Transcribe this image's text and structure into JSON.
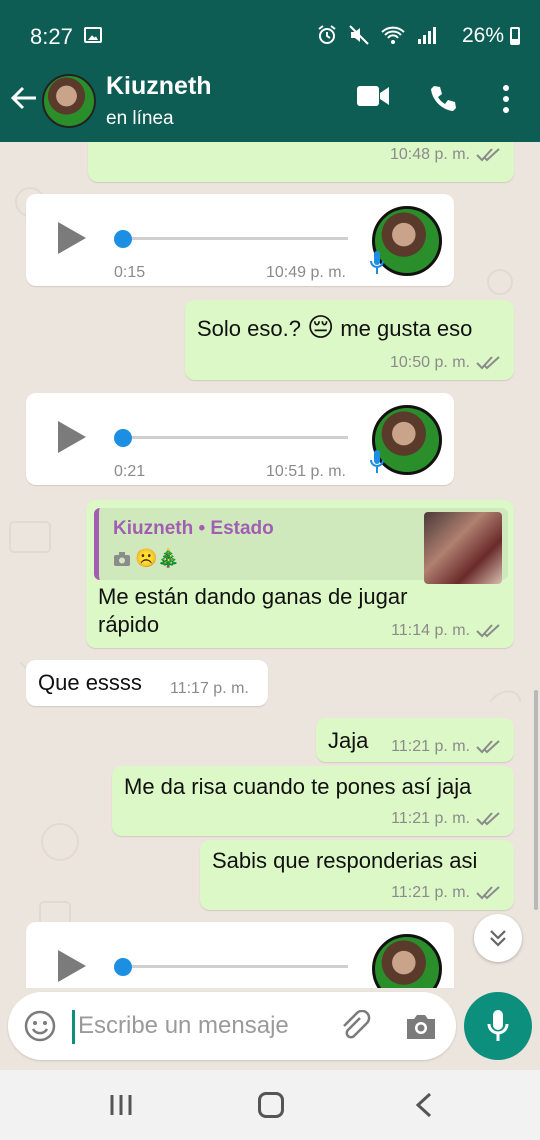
{
  "status_bar": {
    "time": "8:27",
    "battery": "26%",
    "battery_level": 0.26
  },
  "header": {
    "contact_name": "Kiuzneth",
    "contact_status": "en línea"
  },
  "messages": [
    {
      "type": "outgoing-text-partial",
      "time": "10:48 p. m."
    },
    {
      "type": "incoming-voice",
      "duration": "0:15",
      "time": "10:49 p. m."
    },
    {
      "type": "outgoing-text",
      "text_before": "Solo eso.?",
      "emoji": "😔",
      "text_after": "me gusta eso",
      "time": "10:50 p. m."
    },
    {
      "type": "incoming-voice",
      "duration": "0:21",
      "time": "10:51 p. m."
    },
    {
      "type": "outgoing-reply",
      "reply_name": "Kiuzneth • Estado",
      "reply_emojis": "☹️🎄",
      "line1": "Me están dando ganas de jugar",
      "line2": "rápido",
      "time": "11:14 p. m."
    },
    {
      "type": "incoming-text",
      "text": "Que essss",
      "time": "11:17 p. m."
    },
    {
      "type": "outgoing-text",
      "text": "Jaja",
      "time": "11:21 p. m."
    },
    {
      "type": "outgoing-text",
      "text": "Me da risa cuando te pones así jaja",
      "time": "11:21 p. m."
    },
    {
      "type": "outgoing-text",
      "text": "Sabis que responderias asi",
      "time": "11:21 p. m."
    },
    {
      "type": "incoming-voice-partial"
    }
  ],
  "input": {
    "placeholder": "Escribe un mensaje"
  },
  "colors": {
    "header": "#0d5d55",
    "outgoing_bubble": "#dcf8c6",
    "incoming_bubble": "#ffffff",
    "accent": "#0d8f7e",
    "chat_bg": "#ece5dd"
  }
}
